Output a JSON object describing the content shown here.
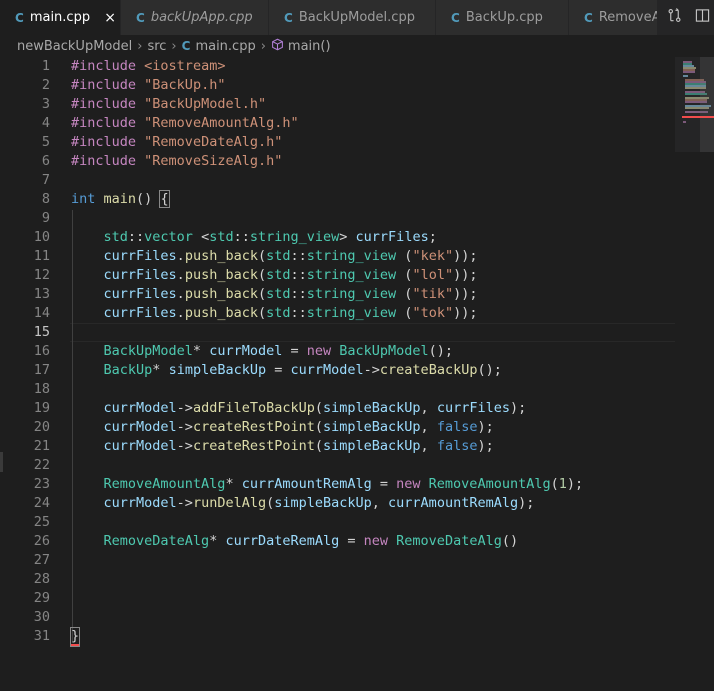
{
  "tabs": [
    {
      "icon": "C",
      "label": "main.cpp",
      "active": true,
      "italic": false,
      "close": "×"
    },
    {
      "icon": "C",
      "label": "backUpApp.cpp",
      "active": false,
      "italic": true
    },
    {
      "icon": "C",
      "label": "BackUpModel.cpp",
      "active": false,
      "italic": false
    },
    {
      "icon": "C",
      "label": "BackUp.cpp",
      "active": false,
      "italic": false
    },
    {
      "icon": "C",
      "label": "RemoveAr",
      "active": false,
      "italic": false
    }
  ],
  "breadcrumb": {
    "folder": "newBackUpModel",
    "subfolder": "src",
    "file": "main.cpp",
    "symbol": "main()",
    "separator": "›"
  },
  "editor": {
    "active_line": 15,
    "line_numbers": [
      "1",
      "2",
      "3",
      "4",
      "5",
      "6",
      "7",
      "8",
      "9",
      "10",
      "11",
      "12",
      "13",
      "14",
      "15",
      "16",
      "17",
      "18",
      "19",
      "20",
      "21",
      "22",
      "23",
      "24",
      "25",
      "26",
      "27",
      "28",
      "29",
      "30",
      "31"
    ],
    "code_lines": [
      "#include <iostream>",
      "#include \"BackUp.h\"",
      "#include \"BackUpModel.h\"",
      "#include \"RemoveAmountAlg.h\"",
      "#include \"RemoveDateAlg.h\"",
      "#include \"RemoveSizeAlg.h\"",
      "",
      "int main() {",
      "",
      "    std::vector <std::string_view> currFiles;",
      "    currFiles.push_back(std::string_view (\"kek\"));",
      "    currFiles.push_back(std::string_view (\"lol\"));",
      "    currFiles.push_back(std::string_view (\"tik\"));",
      "    currFiles.push_back(std::string_view (\"tok\"));",
      "",
      "    BackUpModel* currModel = new BackUpModel();",
      "    BackUp* simpleBackUp = currModel->createBackUp();",
      "",
      "    currModel->addFileToBackUp(simpleBackUp, currFiles);",
      "    currModel->createRestPoint(simpleBackUp, false);",
      "    currModel->createRestPoint(simpleBackUp, false);",
      "",
      "    RemoveAmountAlg* currAmountRemAlg = new RemoveAmountAlg(1);",
      "    currModel->runDelAlg(simpleBackUp, currAmountRemAlg);",
      "",
      "    RemoveDateAlg* currDateRemAlg = new RemoveDateAlg()",
      "",
      "",
      "",
      "",
      "}"
    ]
  },
  "icons": {
    "file_icon": "cpp-file-icon",
    "symbol_icon": "cube-icon",
    "compare_icon": "compare-changes-icon",
    "split_icon": "split-editor-icon"
  },
  "colors": {
    "background": "#1e1e1e",
    "tab_inactive": "#2d2d2d",
    "cpp_icon": "#519aba",
    "keyword": "#569cd6",
    "preprocessor": "#c586c0",
    "string": "#ce9178",
    "type": "#4ec9b0",
    "function": "#dcdcaa",
    "variable": "#9cdcfe",
    "error": "#f14c4c"
  }
}
